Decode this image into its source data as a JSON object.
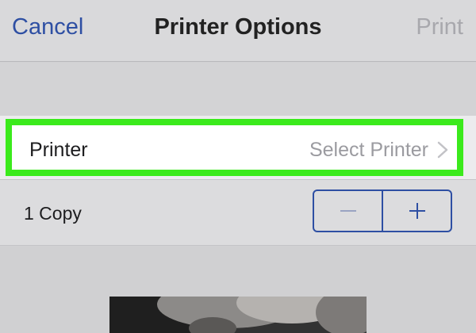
{
  "navbar": {
    "cancel_label": "Cancel",
    "title": "Printer Options",
    "print_label": "Print"
  },
  "printer_row": {
    "label": "Printer",
    "value": "Select Printer",
    "chevron_icon": "chevron-right-icon"
  },
  "copies": {
    "label": "1 Copy",
    "decrement_icon": "minus-icon",
    "increment_icon": "plus-icon"
  },
  "colors": {
    "accent": "#2e4fa3",
    "highlight": "#3bea1c",
    "disabled_text": "#a8a8ad"
  }
}
